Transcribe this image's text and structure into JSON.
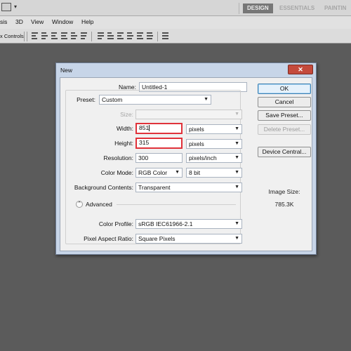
{
  "workspaces": {
    "design": "DESIGN",
    "essentials": "ESSENTIALS",
    "painting": "PAINTIN"
  },
  "menu": {
    "items": [
      "sis",
      "3D",
      "View",
      "Window",
      "Help"
    ]
  },
  "options_bar": {
    "label": "x Controls"
  },
  "dialog": {
    "title": "New",
    "name_label": "Name:",
    "name_value": "Untitled-1",
    "preset_label": "Preset:",
    "preset_value": "Custom",
    "size_label": "Size:",
    "size_value": "",
    "width_label": "Width:",
    "width_value": "851",
    "width_unit": "pixels",
    "height_label": "Height:",
    "height_value": "315",
    "height_unit": "pixels",
    "resolution_label": "Resolution:",
    "resolution_value": "300",
    "resolution_unit": "pixels/inch",
    "color_mode_label": "Color Mode:",
    "color_mode_value": "RGB Color",
    "bit_depth_value": "8 bit",
    "background_label": "Background Contents:",
    "background_value": "Transparent",
    "advanced_label": "Advanced",
    "color_profile_label": "Color Profile:",
    "color_profile_value": "sRGB IEC61966-2.1",
    "pixel_aspect_label": "Pixel Aspect Ratio:",
    "pixel_aspect_value": "Square Pixels",
    "buttons": {
      "ok": "OK",
      "cancel": "Cancel",
      "save_preset": "Save Preset...",
      "delete_preset": "Delete Preset...",
      "device_central": "Device Central..."
    },
    "image_size_label": "Image Size:",
    "image_size_value": "785.3K"
  },
  "icons": {
    "close": "close-icon",
    "dropdown": "chevron-down-icon",
    "advanced_toggle": "chevron-up-icon"
  },
  "colors": {
    "highlight": "#e0323a",
    "close_button": "#c44a3c",
    "background": "#5b5b5b"
  }
}
